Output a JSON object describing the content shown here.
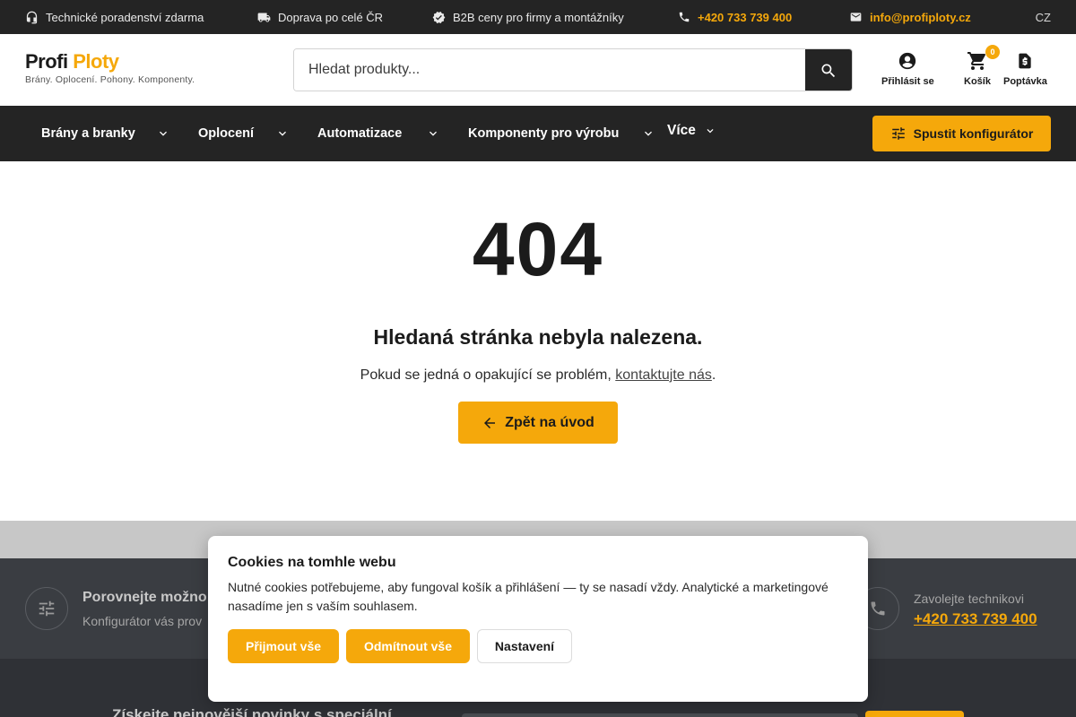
{
  "topbar": {
    "items": [
      {
        "icon": "headset-icon",
        "label": "Technické poradenství zdarma"
      },
      {
        "icon": "truck-icon",
        "label": "Doprava po celé ČR"
      },
      {
        "icon": "verified-icon",
        "label": "B2B ceny pro firmy a montážníky"
      },
      {
        "icon": "phone-icon",
        "label": "+420 733 739 400"
      },
      {
        "icon": "mail-icon",
        "label": "info@profiploty.cz"
      }
    ],
    "language": "CZ"
  },
  "header": {
    "logo_part1": "Profi",
    "logo_part2": "Ploty",
    "tagline": "Brány. Oplocení. Pohony. Komponenty.",
    "search_placeholder": "Hledat produkty...",
    "login_label": "Přihlásit se",
    "cart_label": "Košík",
    "cart_count": "0",
    "inquiry_label": "Poptávka"
  },
  "nav": {
    "items": [
      {
        "label": "Brány a branky"
      },
      {
        "label": "Oplocení"
      },
      {
        "label": "Automatizace"
      },
      {
        "label": "Komponenty pro výrobu"
      },
      {
        "label": "Více"
      }
    ],
    "configurator_label": "Spustit konfigurátor"
  },
  "main": {
    "code": "404",
    "title": "Hledaná stránka nebyla nalezena.",
    "text_before": "Pokud se jedná o opakující se problém, ",
    "link_text": "kontaktujte nás",
    "text_after": ".",
    "home_button": "Zpět na úvod"
  },
  "footer": {
    "compare_title": "Porovnejte možno",
    "compare_sub": "Konfigurátor vás prov",
    "call_title": "Zavolejte technikovi",
    "call_phone": "+420 733 739 400",
    "newsletter_text": "Získejte nejnovější novinky s speciální"
  },
  "cookie": {
    "title": "Cookies na tomhle webu",
    "text": "Nutné cookies potřebujeme, aby fungoval košík a přihlášení — ty se nasadí vždy. Analytické a marketingové nasadíme jen s vaším souhlasem.",
    "accept": "Přijmout vše",
    "reject": "Odmítnout vše",
    "settings": "Nastavení"
  },
  "colors": {
    "accent": "#f5a80b",
    "dark": "#242424"
  }
}
